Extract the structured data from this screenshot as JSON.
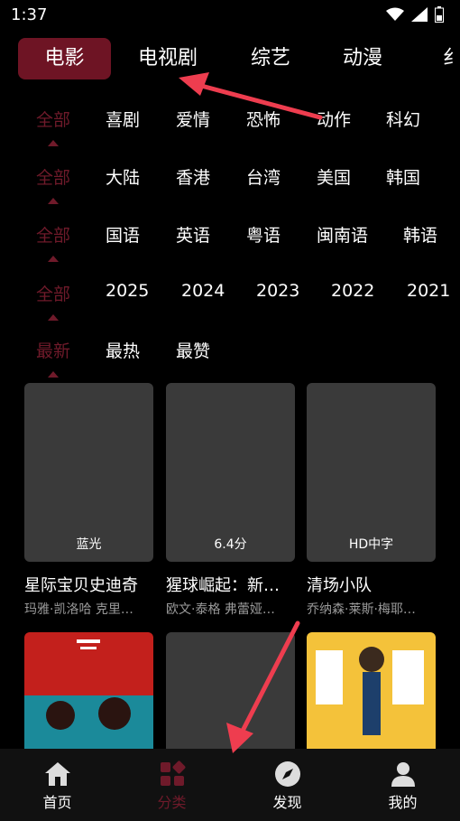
{
  "status": {
    "time": "1:37"
  },
  "tabs": [
    {
      "label": "电影",
      "active": true
    },
    {
      "label": "电视剧"
    },
    {
      "label": "综艺"
    },
    {
      "label": "动漫"
    },
    {
      "label": "纟"
    }
  ],
  "filters": [
    {
      "items": [
        "全部",
        "喜剧",
        "爱情",
        "恐怖",
        "动作",
        "科幻"
      ]
    },
    {
      "items": [
        "全部",
        "大陆",
        "香港",
        "台湾",
        "美国",
        "韩国"
      ]
    },
    {
      "items": [
        "全部",
        "国语",
        "英语",
        "粤语",
        "闽南语",
        "韩语"
      ]
    },
    {
      "items": [
        "全部",
        "2025",
        "2024",
        "2023",
        "2022",
        "2021"
      ]
    },
    {
      "items": [
        "最新",
        "最热",
        "最赞"
      ]
    }
  ],
  "movies": [
    {
      "tag": "蓝光",
      "title": "星际宝贝史迪奇",
      "cast": "玛雅·凯洛哈 克里…"
    },
    {
      "tag": "6.4分",
      "title": "猩球崛起：新…",
      "cast": "欧文·泰格 弗蕾娅…"
    },
    {
      "tag": "HD中字",
      "title": "清场小队",
      "cast": "乔纳森·莱斯·梅耶…"
    }
  ],
  "nav": [
    {
      "label": "首页",
      "icon": "home-icon"
    },
    {
      "label": "分类",
      "icon": "category-icon",
      "active": true
    },
    {
      "label": "发现",
      "icon": "compass-icon"
    },
    {
      "label": "我的",
      "icon": "user-icon"
    }
  ],
  "colors": {
    "accent": "#6e1424",
    "selected_text": "#6f1a2a"
  }
}
